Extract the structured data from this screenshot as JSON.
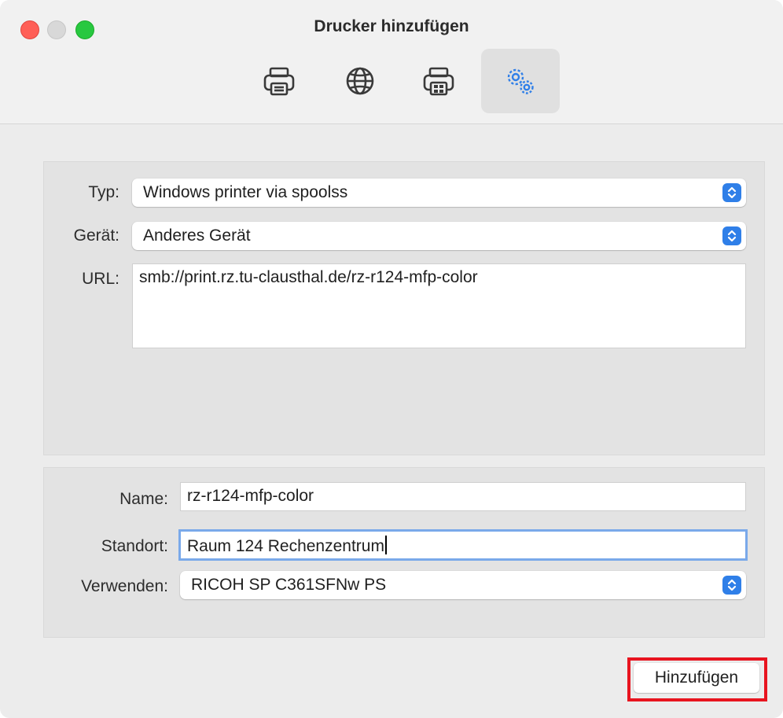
{
  "window": {
    "title": "Drucker hinzufügen"
  },
  "toolbar": {
    "buttons": [
      {
        "icon": "printer-icon",
        "selected": false
      },
      {
        "icon": "globe-icon",
        "selected": false
      },
      {
        "icon": "windows-printer-icon",
        "selected": false
      },
      {
        "icon": "gears-icon",
        "selected": true
      }
    ]
  },
  "form": {
    "typ_label": "Typ:",
    "typ_value": "Windows printer via spoolss",
    "geraet_label": "Gerät:",
    "geraet_value": "Anderes Gerät",
    "url_label": "URL:",
    "url_value": "smb://print.rz.tu-clausthal.de/rz-r124-mfp-color",
    "name_label": "Name:",
    "name_value": "rz-r124-mfp-color",
    "standort_label": "Standort:",
    "standort_value": "Raum 124 Rechenzentrum",
    "verwenden_label": "Verwenden:",
    "verwenden_value": "RICOH SP C361SFNw PS"
  },
  "actions": {
    "add_label": "Hinzufügen"
  },
  "colors": {
    "accent": "#2f7fe8",
    "highlight": "#e8141f"
  }
}
